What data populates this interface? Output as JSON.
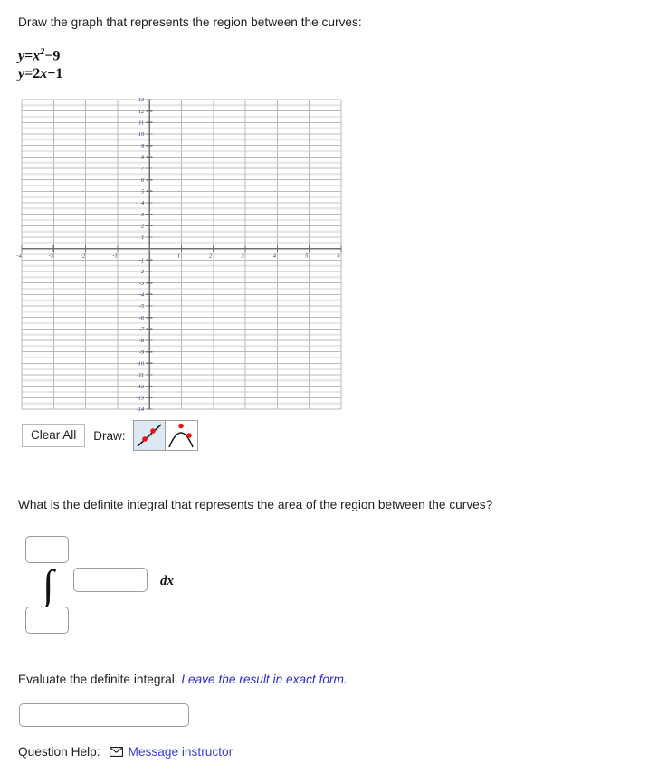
{
  "prompt": {
    "instruction": "Draw the graph that represents the region between the curves:",
    "equations": [
      {
        "lhs": "y",
        "rhs_html": "x2 − 9",
        "plain": "y = x^2 - 9"
      },
      {
        "lhs": "y",
        "rhs_html": "2x − 1",
        "plain": "y = 2x - 1"
      }
    ],
    "eq1_var": "y",
    "eq1_eq": "=",
    "eq1_base": "x",
    "eq1_exp": "2",
    "eq1_minus": "−",
    "eq1_const": "9",
    "eq2_var": "y",
    "eq2_eq": "=",
    "eq2_coef": "2",
    "eq2_base": "x",
    "eq2_minus": "−",
    "eq2_const": "1"
  },
  "graph": {
    "x_ticks": [
      -4,
      -3,
      -2,
      -1,
      1,
      2,
      3,
      4,
      5,
      6
    ],
    "y_ticks": [
      13,
      12,
      11,
      10,
      9,
      8,
      7,
      6,
      5,
      4,
      3,
      2,
      1,
      -1,
      -2,
      -3,
      -4,
      -5,
      -6,
      -7,
      -8,
      -9,
      -10,
      -11,
      -12,
      -13,
      -14
    ],
    "xmin": -4,
    "xmax": 6,
    "ymin": -14,
    "ymax": 13,
    "grid": true,
    "axis_color": "#6f6f6f",
    "major_grid_color": "#b9b9b9",
    "minor_grid_color": "#e8e8e8",
    "tick_label_color": "#2b3a67",
    "drawn_curves": []
  },
  "toolbar": {
    "clear_all_label": "Clear All",
    "draw_label": "Draw:",
    "tools": [
      {
        "name": "line-tool",
        "selected": true,
        "point_color": "#ee1111"
      },
      {
        "name": "parabola-tool",
        "selected": false,
        "point_color": "#ee1111"
      }
    ]
  },
  "integral_question": {
    "text": "What is the definite integral that represents the area of the region between the curves?",
    "integral_glyph": "∫",
    "dx_label": "dx",
    "upper_limit_value": "",
    "lower_limit_value": "",
    "integrand_value": ""
  },
  "evaluate_question": {
    "text": "Evaluate the definite integral. ",
    "hint": "Leave the result in exact form.",
    "answer_value": ""
  },
  "question_help": {
    "label": "Question Help:",
    "link_label": "Message instructor",
    "icon": "envelope-icon",
    "link_color": "#3b3bd8"
  }
}
